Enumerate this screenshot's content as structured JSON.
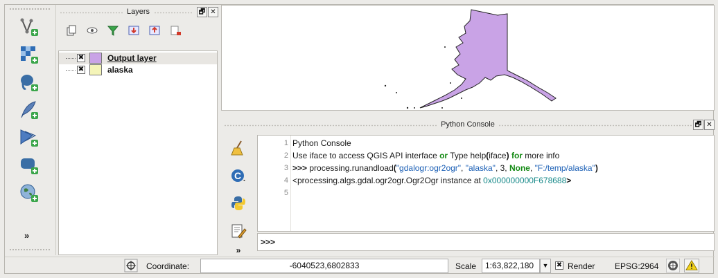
{
  "layers_panel": {
    "title": "Layers",
    "float_button": "🗗",
    "close_button": "✕",
    "layers": [
      {
        "name": "Output layer",
        "checked": "✖",
        "color": "#c9a3e6",
        "selected": true
      },
      {
        "name": "alaska",
        "checked": "✖",
        "color": "#f4f4b8",
        "selected": false
      }
    ]
  },
  "console_panel": {
    "title": "Python Console",
    "float_button": "🗗",
    "close_button": "✕",
    "lines": [
      {
        "n": "1"
      },
      {
        "n": "2"
      },
      {
        "n": "3"
      },
      {
        "n": "4"
      },
      {
        "n": "5"
      }
    ],
    "line1": "Python Console",
    "line2_a": "Use iface to access QGIS API interface ",
    "line2_or": "or",
    "line2_b": " Type help",
    "line2_paren_open": "(",
    "line2_c": "iface",
    "line2_paren_close": ")",
    "line2_for": " for",
    "line2_d": " more info",
    "line3_prompt": ">>>",
    "line3_call": " processing.runandload",
    "line3_paren_open": "(",
    "line3_arg1": "\"gdalogr:ogr2ogr\"",
    "line3_sep1": ", ",
    "line3_arg2": "\"alaska\"",
    "line3_sep2": ", 3, ",
    "line3_none": "None",
    "line3_sep3": ", ",
    "line3_arg4": "\"F:/temp/alaska\"",
    "line3_paren_close": ")",
    "line4_a": "<processing.algs.gdal.ogr2ogr.Ogr2Ogr instance at ",
    "line4_hex": "0x000000000F678688",
    "line4_close": ">",
    "input_prompt": ">>>",
    "more_label": "»"
  },
  "left_toolbar": {
    "more_label": "»",
    "tools": [
      "add-vector-layer-icon",
      "add-raster-layer-icon",
      "add-postgis-layer-icon",
      "add-delimited-text-layer-icon",
      "add-wms-layer-icon",
      "add-spatialite-layer-icon",
      "add-wcs-layer-icon"
    ]
  },
  "status_bar": {
    "coordinate_label": "Coordinate:",
    "coordinate_value": "-6040523,6802833",
    "scale_label": "Scale",
    "scale_value": "1:63,822,180",
    "scale_dropdown": "▼",
    "render_checked": "✖",
    "render_label": "Render",
    "epsg_label": "EPSG:2964"
  },
  "colors": {
    "output_layer_fill": "#c9a3e6",
    "alaska_fill": "#f4f4b8",
    "keyword_green": "#148a14",
    "string_blue": "#1b5fb5",
    "hex_teal": "#188a8a"
  }
}
